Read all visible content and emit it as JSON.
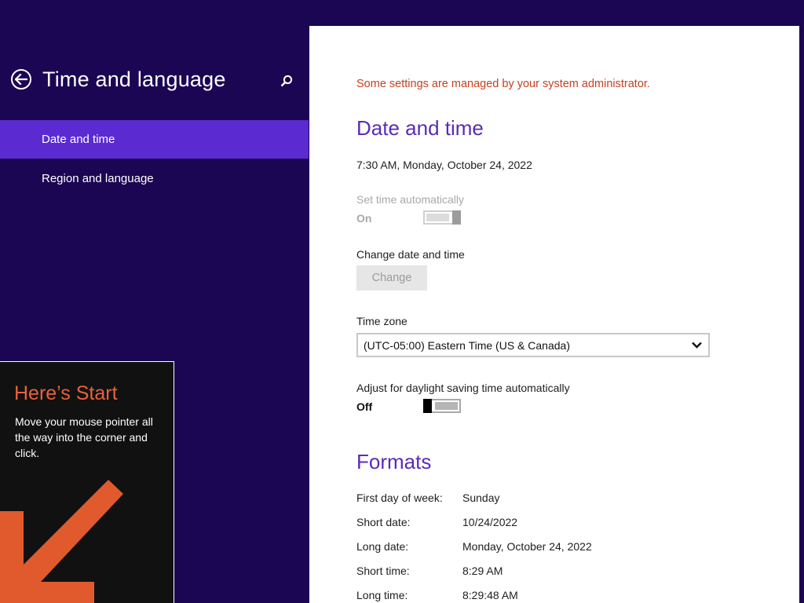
{
  "sidebar": {
    "title": "Time and language",
    "items": [
      {
        "label": "Date and time"
      },
      {
        "label": "Region and language"
      }
    ]
  },
  "start_tip": {
    "title": "Here’s Start",
    "body": "Move your mouse pointer all the way into the corner and click."
  },
  "content": {
    "admin_notice": "Some settings are managed by your system administrator.",
    "date_time": {
      "heading": "Date and time",
      "current": "7:30 AM, Monday, October 24, 2022",
      "set_auto_label": "Set time automatically",
      "set_auto_state": "On",
      "change_label": "Change date and time",
      "change_button": "Change",
      "timezone_label": "Time zone",
      "timezone_value": "(UTC-05:00) Eastern Time (US & Canada)",
      "dst_label": "Adjust for daylight saving time automatically",
      "dst_state": "Off"
    },
    "formats": {
      "heading": "Formats",
      "rows": [
        {
          "label": "First day of week:",
          "value": "Sunday"
        },
        {
          "label": "Short date:",
          "value": "10/24/2022"
        },
        {
          "label": "Long date:",
          "value": "Monday, October 24, 2022"
        },
        {
          "label": "Short time:",
          "value": "8:29 AM"
        },
        {
          "label": "Long time:",
          "value": "8:29:48 AM"
        }
      ]
    }
  },
  "colors": {
    "background": "#1b0653",
    "nav_selected": "#5b2bd1",
    "accent_heading": "#5b2bb6",
    "admin_notice": "#c6411f",
    "start_tip_accent": "#e8623c"
  },
  "icons": [
    "back-arrow-icon",
    "search-icon",
    "chevron-down-icon",
    "start-arrow-icon"
  ]
}
